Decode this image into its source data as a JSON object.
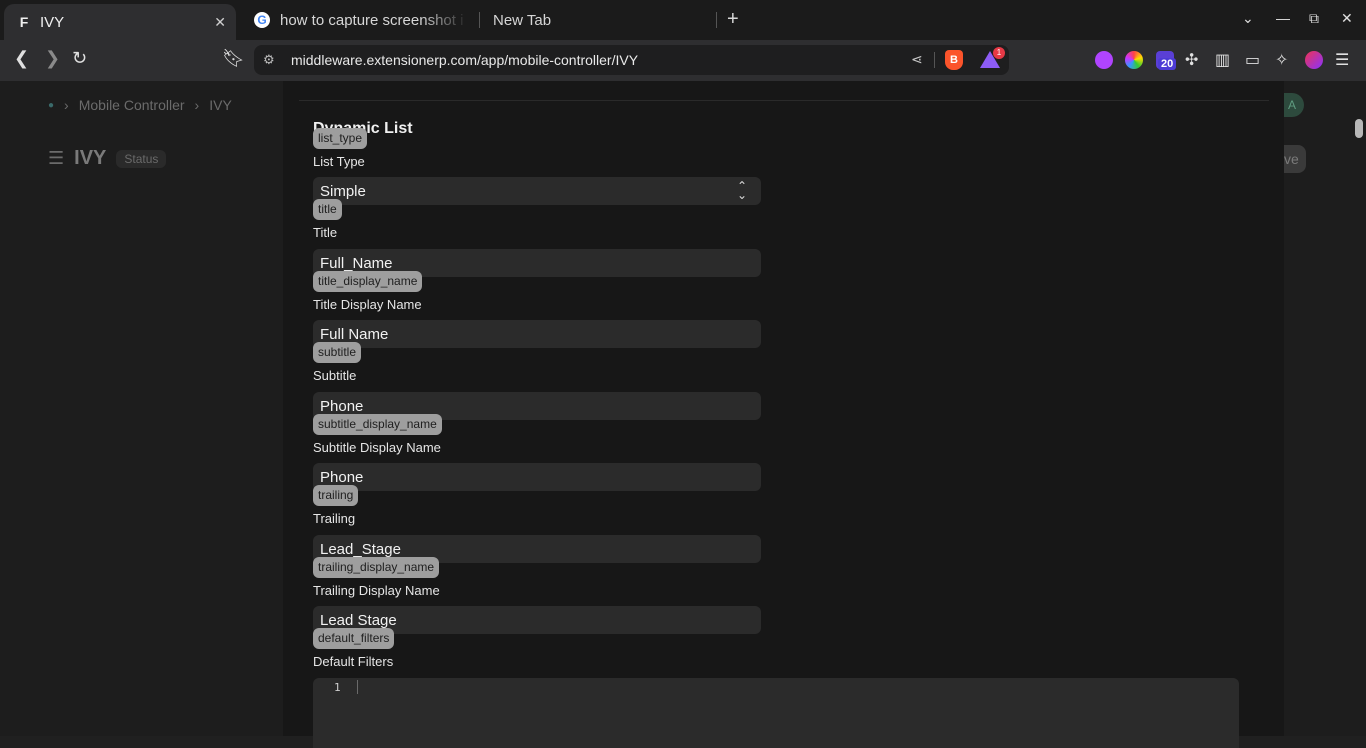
{
  "browser": {
    "tabs": [
      {
        "title": "IVY",
        "favicon": "F",
        "active": true
      },
      {
        "title": "how to capture screenshot i",
        "favicon": "G",
        "active": false
      },
      {
        "title": "New Tab",
        "active": false
      }
    ],
    "address_url": "middleware.extensionerp.com/app/mobile-controller/IVY",
    "extension_badge": "20",
    "rewards_badge": "1"
  },
  "background_page": {
    "breadcrumbs": [
      "Mobile Controller",
      "IVY"
    ],
    "title": "IVY",
    "status": "Status",
    "avatar_letter": "A",
    "save_label_fragment": "ve"
  },
  "dialog": {
    "section_title": "Dynamic List",
    "fields": [
      {
        "fieldname": "list_type",
        "label": "List Type",
        "value": "Simple",
        "type": "select"
      },
      {
        "fieldname": "title",
        "label": "Title",
        "value": "Full_Name",
        "type": "data"
      },
      {
        "fieldname": "title_display_name",
        "label": "Title Display Name",
        "value": "Full Name",
        "type": "data"
      },
      {
        "fieldname": "subtitle",
        "label": "Subtitle",
        "value": "Phone",
        "type": "data"
      },
      {
        "fieldname": "subtitle_display_name",
        "label": "Subtitle Display Name",
        "value": "Phone",
        "type": "data"
      },
      {
        "fieldname": "trailing",
        "label": "Trailing",
        "value": "Lead_Stage",
        "type": "data"
      },
      {
        "fieldname": "trailing_display_name",
        "label": "Trailing Display Name",
        "value": "Lead Stage",
        "type": "data"
      }
    ],
    "default_filters": {
      "fieldname": "default_filters",
      "label": "Default Filters",
      "line_number": "1"
    }
  }
}
